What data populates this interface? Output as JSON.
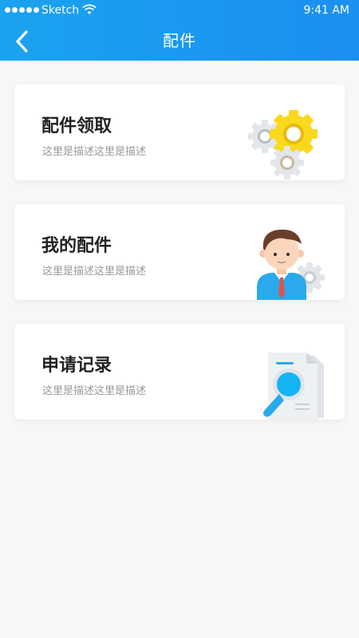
{
  "status_bar": {
    "carrier": "Sketch",
    "time": "9:41 AM"
  },
  "header": {
    "title": "配件"
  },
  "cards": [
    {
      "title": "配件领取",
      "description": "这里是描述这里是描述",
      "illustration": "gears-icon"
    },
    {
      "title": "我的配件",
      "description": "这里是描述这里是描述",
      "illustration": "person-icon"
    },
    {
      "title": "申请记录",
      "description": "这里是描述这里是描述",
      "illustration": "document-search-icon"
    }
  ],
  "colors": {
    "header": "#1b9af0",
    "background": "#f7f7f7",
    "title": "#222222",
    "description": "#999999"
  }
}
